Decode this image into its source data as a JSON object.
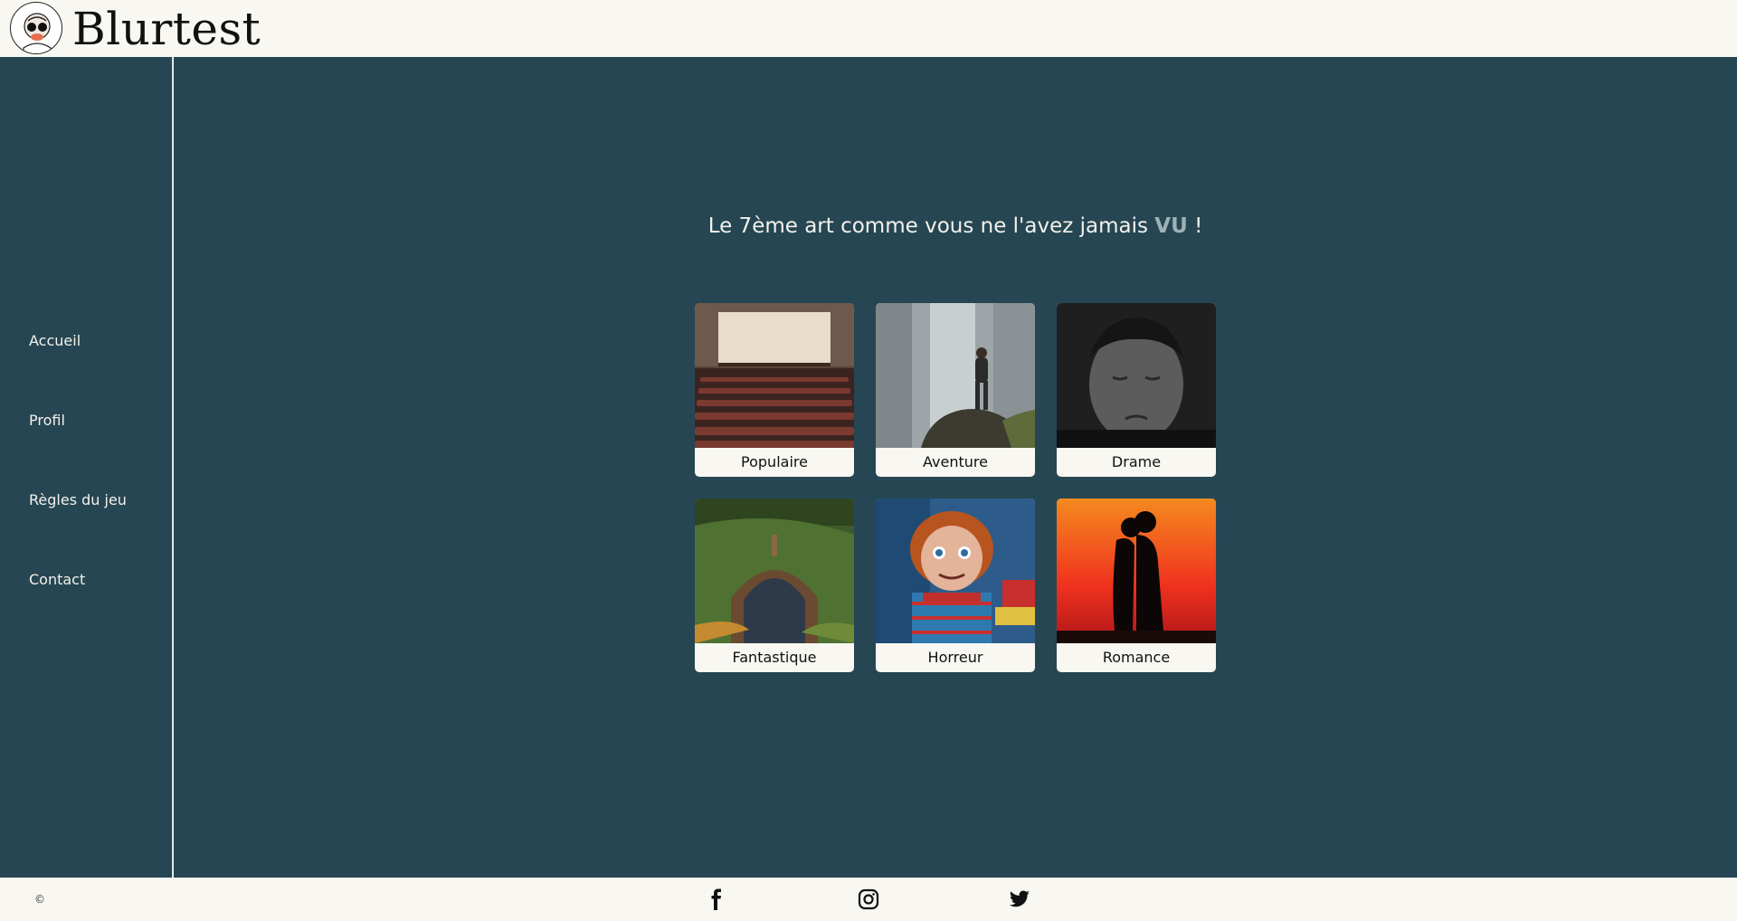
{
  "header": {
    "brand": "Blurtest",
    "logo_icon": "blurred-face-logo-icon"
  },
  "sidebar": {
    "items": [
      {
        "label": "Accueil"
      },
      {
        "label": "Profil"
      },
      {
        "label": "Règles du jeu"
      },
      {
        "label": "Contact"
      }
    ]
  },
  "main": {
    "tagline_before": "Le 7ème art comme vous ne l'avez jamais ",
    "tagline_accent": "VU",
    "tagline_after": " !",
    "categories": [
      {
        "label": "Populaire",
        "image": "cinema-theater-image"
      },
      {
        "label": "Aventure",
        "image": "hiker-on-rock-waterfall-image"
      },
      {
        "label": "Drame",
        "image": "sad-boy-portrait-image"
      },
      {
        "label": "Fantastique",
        "image": "hobbit-house-image"
      },
      {
        "label": "Horreur",
        "image": "chucky-doll-image"
      },
      {
        "label": "Romance",
        "image": "couple-silhouette-sunset-image"
      }
    ]
  },
  "footer": {
    "copyright": "©",
    "social": [
      "facebook-icon",
      "instagram-icon",
      "twitter-icon"
    ]
  },
  "colors": {
    "panel": "#264653",
    "cream": "#F8F7F1",
    "accent_text": "#9EB2B6"
  }
}
